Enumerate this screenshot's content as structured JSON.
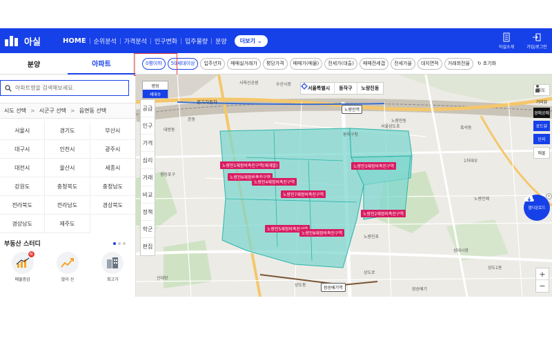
{
  "brand": {
    "name": "아실"
  },
  "nav": {
    "items": [
      "HOME",
      "순위분석",
      "가격분석",
      "인구변화",
      "입주물량",
      "분양"
    ],
    "more_label": "더보기",
    "right": [
      {
        "label": "아실소개"
      },
      {
        "label": "가입/로그인"
      }
    ]
  },
  "sidebar": {
    "tabs": [
      "분양",
      "아파트"
    ],
    "active_tab": "아파트",
    "search_placeholder": "아파트명을 검색해보세요.",
    "region_steps": [
      "시도 선택",
      "시군구 선택",
      "읍면동 선택"
    ],
    "cities": [
      "서울시",
      "경기도",
      "부산시",
      "대구시",
      "인천시",
      "광주시",
      "대전시",
      "울산시",
      "세종시",
      "강원도",
      "충청북도",
      "충청남도",
      "전라북도",
      "전라남도",
      "경상북도",
      "경상남도",
      "제주도"
    ],
    "study": {
      "title": "부동산 스터디",
      "items": [
        {
          "label": "매물증감"
        },
        {
          "label": "많이 산"
        },
        {
          "label": "최고가"
        }
      ]
    }
  },
  "filters": {
    "chips": [
      "0평이하",
      "50세대이상",
      "입주년차",
      "매매실거래가",
      "평당가격",
      "매매가(매물)",
      "전세가(대출)",
      "매매전세갭",
      "전세가율",
      "대지면적",
      "거래회전율"
    ],
    "reset_label": "초기화"
  },
  "map": {
    "location": [
      "서울특별시",
      "동작구",
      "노량진동"
    ],
    "left_menu": [
      "공급",
      "인구",
      "가격",
      "심리",
      "거래",
      "비교",
      "정책",
      "학군",
      "편집"
    ],
    "popup": [
      "평형",
      "세대수"
    ],
    "popup_selected": "세대수",
    "zones": [
      "노량진1재정비촉진구역(재개발)",
      "노량진6재정비촉진구역",
      "노량진4재정비촉진구역",
      "노량진3재정비촉진구역",
      "노량진7재정비촉진구역",
      "노량진2재정비촉진구역",
      "노량진5재정비촉진구역",
      "노량진8재정비촉진구역"
    ],
    "stations": [
      "노량진역",
      "장승배기역"
    ],
    "labels": [
      "전기자동차",
      "수산시장",
      "사육신공원",
      "본동",
      "노량진동",
      "흑석동",
      "동작구청",
      "서울상도초",
      "상도동",
      "대방동",
      "노량진초",
      "영등포구",
      "신대방",
      "상도로",
      "성대시장",
      "상도1동",
      "장승배기",
      "노량진제",
      "1차대우"
    ],
    "right_tools": [
      "지도",
      "거리뷰",
      "경매공매",
      "로드뷰",
      "단지",
      "매물"
    ],
    "download_label": "앱다운로드"
  }
}
